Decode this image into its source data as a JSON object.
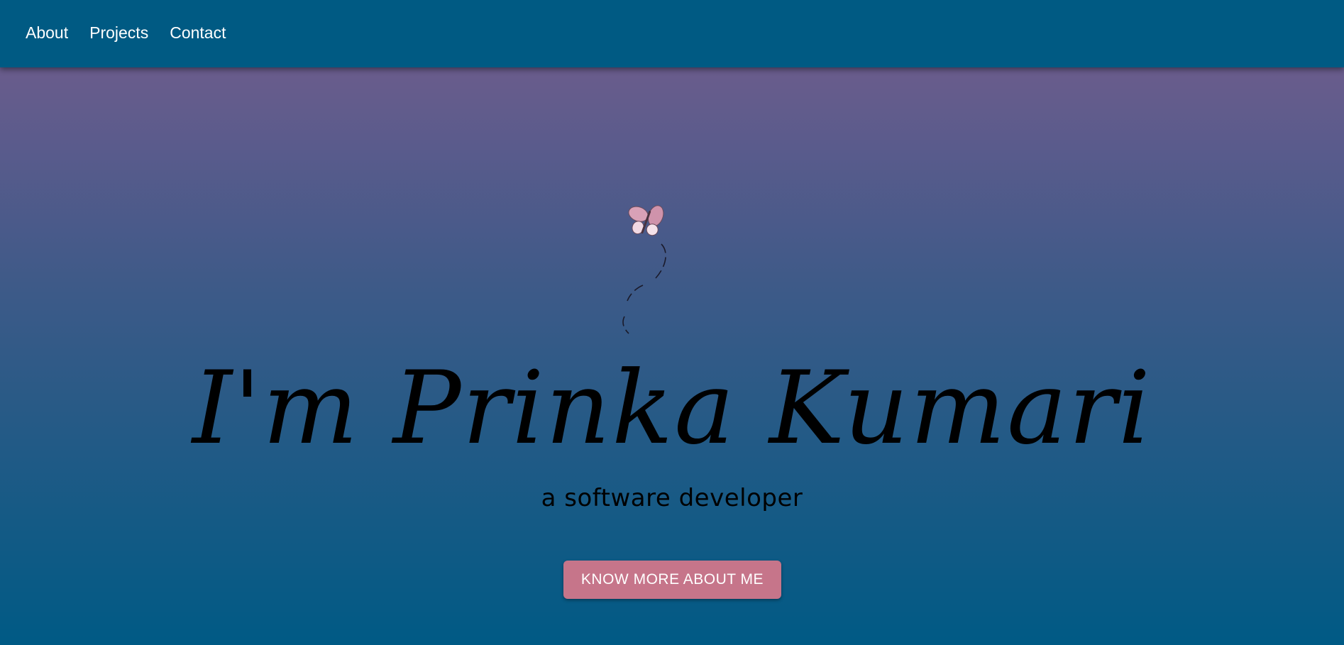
{
  "nav": {
    "items": [
      {
        "label": "About"
      },
      {
        "label": "Projects"
      },
      {
        "label": "Contact"
      }
    ]
  },
  "hero": {
    "title": "I'm Prinka Kumari",
    "subtitle": "a software developer",
    "cta_label": "KNOW MORE ABOUT ME",
    "illustration": "butterfly-icon"
  },
  "colors": {
    "nav_background": "#005a83",
    "gradient_top": "#775e8c",
    "gradient_bottom": "#005a85",
    "button_background": "#c6758a",
    "nav_text": "#ffffff",
    "title_text": "#000000"
  }
}
